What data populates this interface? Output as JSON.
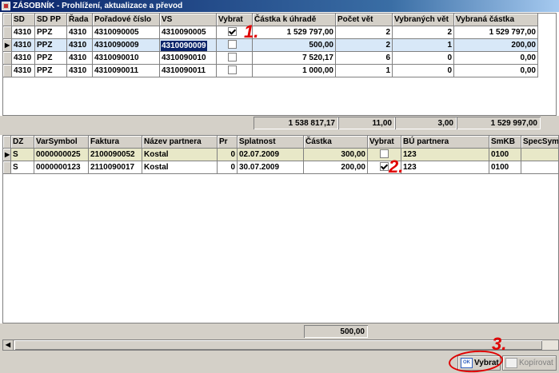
{
  "window": {
    "title": "ZÁSOBNÍK - Prohlížení, aktualizace a převod"
  },
  "grid1": {
    "columns": [
      "SD",
      "SD PP",
      "Řada",
      "Pořadové číslo",
      "VS",
      "Vybrat",
      "Částka k úhradě",
      "Počet vět",
      "Vybraných vět",
      "Vybraná částka"
    ],
    "rows": [
      {
        "sd": "4310",
        "sdpp": "PPZ",
        "rada": "4310",
        "poradove": "4310090005",
        "vs": "4310090005",
        "vybrat": true,
        "castka": "1 529 797,00",
        "pocet": "2",
        "vybranych": "2",
        "vybrana": "1 529 797,00",
        "indicator": ""
      },
      {
        "sd": "4310",
        "sdpp": "PPZ",
        "rada": "4310",
        "poradove": "4310090009",
        "vs": "4310090009",
        "vybrat": false,
        "castka": "500,00",
        "pocet": "2",
        "vybranych": "1",
        "vybrana": "200,00",
        "indicator": "▶"
      },
      {
        "sd": "4310",
        "sdpp": "PPZ",
        "rada": "4310",
        "poradove": "4310090010",
        "vs": "4310090010",
        "vybrat": false,
        "castka": "7 520,17",
        "pocet": "6",
        "vybranych": "0",
        "vybrana": "0,00",
        "indicator": ""
      },
      {
        "sd": "4310",
        "sdpp": "PPZ",
        "rada": "4310",
        "poradove": "4310090011",
        "vs": "4310090011",
        "vybrat": false,
        "castka": "1 000,00",
        "pocet": "1",
        "vybranych": "0",
        "vybrana": "0,00",
        "indicator": ""
      }
    ],
    "totals": {
      "castka": "1 538 817,17",
      "pocet": "11,00",
      "vybranych": "3,00",
      "vybrana": "1 529 997,00"
    }
  },
  "grid2": {
    "columns": [
      "DZ",
      "VarSymbol",
      "Faktura",
      "Název partnera",
      "Pr",
      "Splatnost",
      "Částka",
      "Vybrat",
      "BÚ partnera",
      "SmKB",
      "SpecSym"
    ],
    "rows": [
      {
        "dz": "S",
        "varsymbol": "0000000025",
        "faktura": "2100090052",
        "nazev": "Kostal",
        "pr": "0",
        "splatnost": "02.07.2009",
        "castka": "300,00",
        "vybrat": false,
        "bu": "123",
        "smkb": "0100",
        "specsym": "",
        "indicator": "▶"
      },
      {
        "dz": "S",
        "varsymbol": "0000000123",
        "faktura": "2110090017",
        "nazev": "Kostal",
        "pr": "0",
        "splatnost": "30.07.2009",
        "castka": "200,00",
        "vybrat": true,
        "bu": "123",
        "smkb": "0100",
        "specsym": "",
        "indicator": ""
      }
    ],
    "total": "500,00"
  },
  "buttons": {
    "ok_icon": "OK",
    "ok_label": "Vybrat",
    "copy_label": "Kopírovat"
  },
  "annotations": {
    "a1": "1.",
    "a2": "2.",
    "a3": "3."
  },
  "colors": {
    "annotation": "#e00000",
    "selected_row": "#d8e8f8",
    "highlight": "#0a246a",
    "row2_bg": "#e8e8c8"
  }
}
